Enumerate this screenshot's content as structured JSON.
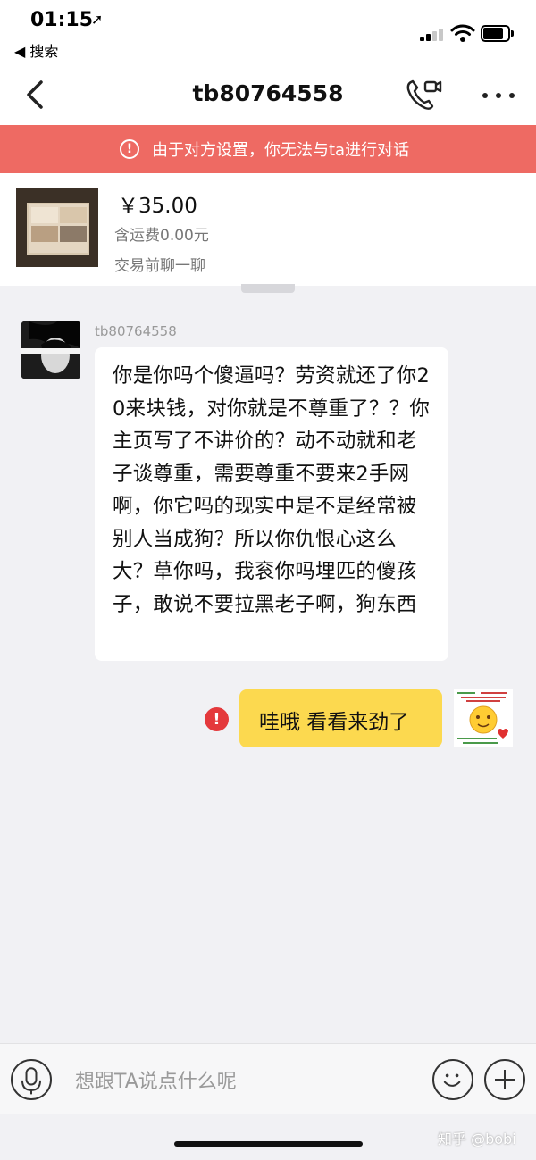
{
  "status_bar": {
    "time": "01:15",
    "location_icon": "location-arrow-icon",
    "back_app": "◀ 搜索"
  },
  "nav": {
    "title": "tb80764558",
    "back_icon": "chevron-left-icon",
    "call_icon": "phone-video-icon",
    "more_icon": "more-dots-icon"
  },
  "warning": {
    "icon": "info-circle-icon",
    "text": "由于对方设置，你无法与ta进行对话",
    "color": "#ee6a63"
  },
  "product": {
    "price": "￥35.00",
    "shipping": "含运费0.00元",
    "prompt": "交易前聊一聊"
  },
  "messages": [
    {
      "direction": "incoming",
      "sender": "tb80764558",
      "text": "你是你吗个傻逼吗？劳资就还了你20来块钱，对你就是不尊重了？？你主页写了不讲价的？动不动就和老子谈尊重，需要尊重不要来2手网啊，你它吗的现实中是不是经常被别人当成狗？所以你仇恨心这么大？草你吗，我衮你吗埋匹的傻孩子，敢说不要拉黑老子啊，狗东西"
    },
    {
      "direction": "outgoing",
      "text": "哇哦 看看来劲了",
      "status": "failed",
      "status_icon": "error-exclamation-icon",
      "bubble_color": "#fcd94f"
    }
  ],
  "input_bar": {
    "placeholder": "想跟TA说点什么呢",
    "voice_icon": "microphone-icon",
    "emoji_icon": "smiley-icon",
    "plus_icon": "plus-icon"
  },
  "watermark": "知乎 @bobi"
}
